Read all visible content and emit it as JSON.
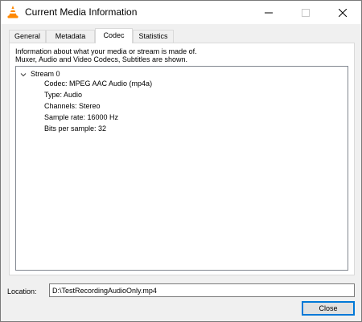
{
  "window": {
    "title": "Current Media Information",
    "icon": "vlc-cone-icon",
    "controls": [
      "minimize-icon",
      "maximize-icon",
      "close-icon"
    ]
  },
  "tabs": [
    {
      "label": "General",
      "active": false
    },
    {
      "label": "Metadata",
      "active": false
    },
    {
      "label": "Codec",
      "active": true
    },
    {
      "label": "Statistics",
      "active": false
    }
  ],
  "codec": {
    "description_line1": "Information about what your media or stream is made of.",
    "description_line2": "Muxer, Audio and Video Codecs, Subtitles are shown.",
    "tree": {
      "root_label": "Stream 0",
      "expanded": true,
      "items": [
        "Codec: MPEG AAC Audio (mp4a)",
        "Type: Audio",
        "Channels: Stereo",
        "Sample rate: 16000 Hz",
        "Bits per sample: 32"
      ]
    }
  },
  "location": {
    "label": "Location:",
    "value": "D:\\TestRecordingAudioOnly.mp4"
  },
  "buttons": {
    "close_label": "Close"
  },
  "colors": {
    "accent": "#0078d7",
    "window_bg": "#f0f0f0",
    "vlc_orange": "#ff8800"
  }
}
